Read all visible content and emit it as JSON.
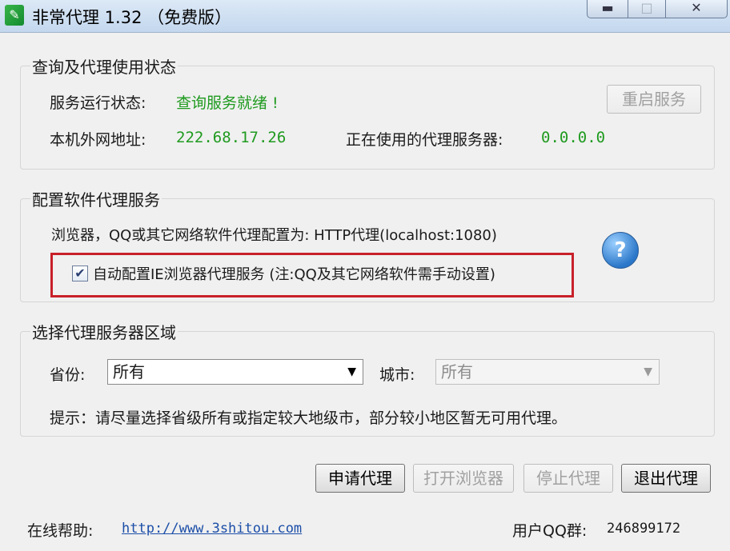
{
  "window": {
    "title": "非常代理 1.32 （免费版）",
    "min_glyph": "▬",
    "max_glyph": "□",
    "close_glyph": "✕"
  },
  "status_group": {
    "title": "查询及代理使用状态",
    "service_label": "服务运行状态:",
    "service_value": "查询服务就绪 !",
    "restart_button": "重启服务",
    "ip_label": "本机外网地址:",
    "ip_value": "222.68.17.26",
    "proxy_label": "正在使用的代理服务器:",
    "proxy_value": "0.0.0.0"
  },
  "config_group": {
    "title": "配置软件代理服务",
    "info_text": "浏览器，QQ或其它网络软件代理配置为: HTTP代理(localhost:1080)",
    "auto_config_checked": true,
    "auto_config_label": "自动配置IE浏览器代理服务 (注:QQ及其它网络软件需手动设置)",
    "help_glyph": "?"
  },
  "region_group": {
    "title": "选择代理服务器区域",
    "province_label": "省份:",
    "province_value": "所有",
    "city_label": "城市:",
    "city_value": "所有",
    "hint": "提示：请尽量选择省级所有或指定较大地级市，部分较小地区暂无可用代理。"
  },
  "actions": {
    "apply": "申请代理",
    "open_browser": "打开浏览器",
    "stop": "停止代理",
    "exit": "退出代理"
  },
  "footer": {
    "help_label": "在线帮助:",
    "help_link": "http://www.3shitou.com",
    "qq_label": "用户QQ群:",
    "qq_value": "246899172"
  },
  "colors": {
    "status_green": "#1f9a1f",
    "highlight_red": "#c8202a",
    "link_blue": "#1c4ea8"
  }
}
